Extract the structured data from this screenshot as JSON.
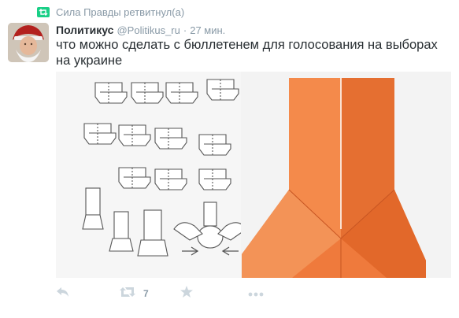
{
  "retweet_context": {
    "text": "Сила Правды ретвитнул(а)",
    "icon": "retweet-icon"
  },
  "tweet": {
    "author_name": "Политикус",
    "author_handle": "@Politikus_ru",
    "separator": "·",
    "time": "27 мин.",
    "text": "что можно сделать с бюллетенем для голосования на выборах на украине",
    "media": {
      "type": "origami-diagram-photo",
      "paper_color": "#f07c3e"
    }
  },
  "actions": {
    "reply": {
      "icon": "reply-icon"
    },
    "retweet": {
      "icon": "retweet-icon",
      "count": "7"
    },
    "favorite": {
      "icon": "star-icon"
    },
    "more": {
      "icon": "more-icon"
    }
  },
  "colors": {
    "muted": "#8899a6",
    "retweet_green": "#19cf86",
    "text": "#292f33"
  }
}
